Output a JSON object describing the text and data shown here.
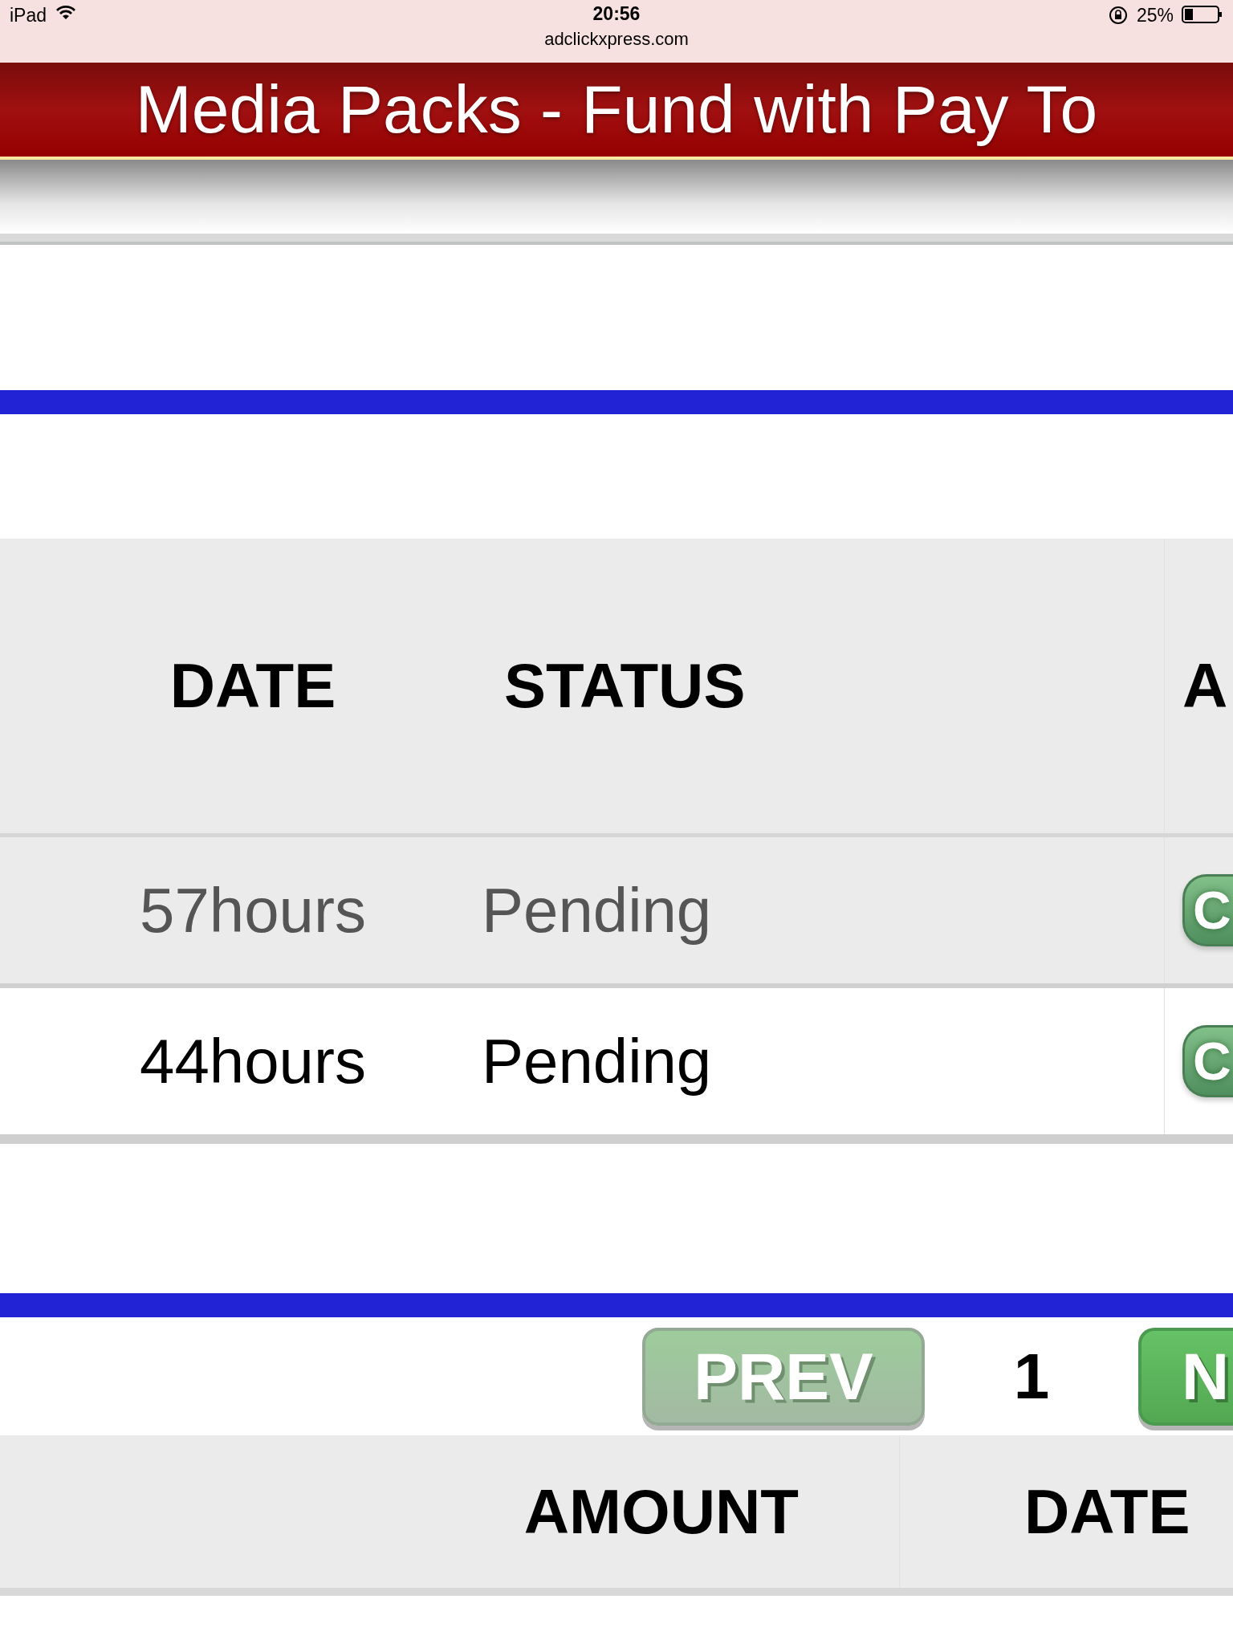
{
  "status_bar": {
    "device": "iPad",
    "time": "20:56",
    "battery": "25%",
    "url": "adclickxpress.com"
  },
  "header": {
    "title": "Media Packs - Fund with Pay To"
  },
  "table": {
    "columns": [
      "DATE",
      "STATUS",
      "A"
    ],
    "rows": [
      {
        "date": "57hours",
        "status": "Pending",
        "action": "C",
        "highlighted": true
      },
      {
        "date": "44hours",
        "status": "Pending",
        "action": "C",
        "highlighted": false
      }
    ]
  },
  "pagination": {
    "prev": {
      "label": "PREV",
      "disabled": true
    },
    "page": "1",
    "next": {
      "label": "N",
      "disabled": false
    }
  },
  "table_2": {
    "columns": [
      "AMOUNT",
      "DATE"
    ]
  }
}
